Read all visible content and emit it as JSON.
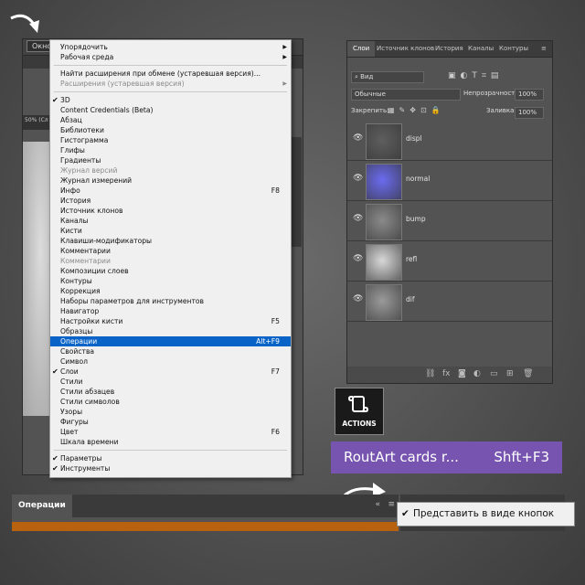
{
  "window_menu": {
    "label": "Окно",
    "items": [
      {
        "label": "Упорядочить",
        "submenu": true
      },
      {
        "label": "Рабочая среда",
        "submenu": true
      },
      {
        "sep": true
      },
      {
        "label": "Найти расширения при обмене (устаревшая версия)..."
      },
      {
        "label": "Расширения (устаревшая версия)",
        "disabled": true,
        "submenu": true
      },
      {
        "sep": true
      },
      {
        "label": "3D",
        "checked": true
      },
      {
        "label": "Content Credentials (Beta)"
      },
      {
        "label": "Абзац"
      },
      {
        "label": "Библиотеки"
      },
      {
        "label": "Гистограмма"
      },
      {
        "label": "Глифы"
      },
      {
        "label": "Градиенты"
      },
      {
        "label": "Журнал версий",
        "disabled": true
      },
      {
        "label": "Журнал измерений"
      },
      {
        "label": "Инфо",
        "shortcut": "F8"
      },
      {
        "label": "История"
      },
      {
        "label": "Источник клонов"
      },
      {
        "label": "Каналы"
      },
      {
        "label": "Кисти"
      },
      {
        "label": "Клавиши-модификаторы"
      },
      {
        "label": "Комментарии"
      },
      {
        "label": "Комментарии",
        "disabled": true
      },
      {
        "label": "Композиции слоев"
      },
      {
        "label": "Контуры"
      },
      {
        "label": "Коррекция"
      },
      {
        "label": "Наборы параметров для инструментов"
      },
      {
        "label": "Навигатор"
      },
      {
        "label": "Настройки кисти",
        "shortcut": "F5"
      },
      {
        "label": "Образцы"
      },
      {
        "label": "Операции",
        "shortcut": "Alt+F9",
        "highlighted": true
      },
      {
        "label": "Свойства"
      },
      {
        "label": "Символ"
      },
      {
        "label": "Слои",
        "shortcut": "F7",
        "checked": true
      },
      {
        "label": "Стили"
      },
      {
        "label": "Стили абзацев"
      },
      {
        "label": "Стили символов"
      },
      {
        "label": "Узоры"
      },
      {
        "label": "Фигуры"
      },
      {
        "label": "Цвет",
        "shortcut": "F6"
      },
      {
        "label": "Шкала времени"
      },
      {
        "sep": true
      },
      {
        "label": "Параметры",
        "checked": true
      },
      {
        "label": "Инструменты",
        "checked": true
      }
    ]
  },
  "layers_panel": {
    "tabs": [
      "Слои",
      "Источник клонов",
      "История",
      "Каналы",
      "Контуры"
    ],
    "filter_label": "Вид",
    "blend_mode": "Обычные",
    "opacity_label": "Непрозрачность:",
    "opacity_value": "100%",
    "lock_label": "Закрепить:",
    "fill_label": "Заливка:",
    "fill_value": "100%",
    "layers": [
      {
        "name": "displ",
        "thumb": "#5e5e5e"
      },
      {
        "name": "normal",
        "thumb": "#6b6bf0"
      },
      {
        "name": "bump",
        "thumb": "#8a8a8a"
      },
      {
        "name": "refl",
        "thumb": "#d8d8d8"
      },
      {
        "name": "dif",
        "thumb": "#9a9a9a"
      }
    ]
  },
  "actions_icon_label": "ACTIONS",
  "action_button": {
    "name": "RoutArt cards r...",
    "shortcut": "Shft+F3"
  },
  "operations_panel": {
    "title": "Операции"
  },
  "context_menu": {
    "label": "Представить в виде кнопок"
  },
  "colors": {
    "highlight": "#0a64c8",
    "purple": "#7654b0",
    "orange": "#b8620f"
  }
}
